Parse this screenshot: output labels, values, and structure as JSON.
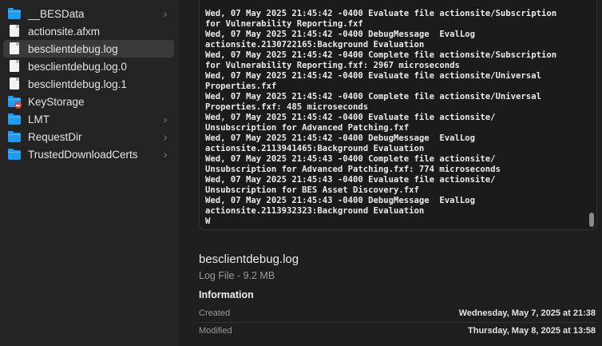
{
  "sidebar": {
    "items": [
      {
        "label": "__BESData",
        "icon": "folder-icon",
        "chevron": "›"
      },
      {
        "label": "actionsite.afxm",
        "icon": "document-icon",
        "chevron": ""
      },
      {
        "label": "besclientdebug.log",
        "icon": "document-icon",
        "chevron": ""
      },
      {
        "label": "besclientdebug.log.0",
        "icon": "document-icon",
        "chevron": ""
      },
      {
        "label": "besclientdebug.log.1",
        "icon": "document-icon",
        "chevron": ""
      },
      {
        "label": "KeyStorage",
        "icon": "folder-restricted-icon",
        "chevron": ""
      },
      {
        "label": "LMT",
        "icon": "folder-icon",
        "chevron": "›"
      },
      {
        "label": "RequestDir",
        "icon": "folder-icon",
        "chevron": "›"
      },
      {
        "label": "TrustedDownloadCerts",
        "icon": "folder-icon",
        "chevron": "›"
      }
    ],
    "selected_index": 2
  },
  "preview": {
    "log_lines": [
      "Wed, 07 May 2025 21:45:42 -0400 Evaluate file actionsite/Subscription",
      "for Vulnerability Reporting.fxf",
      "Wed, 07 May 2025 21:45:42 -0400 DebugMessage  EvalLog",
      "actionsite.2130722165:Background Evaluation",
      "Wed, 07 May 2025 21:45:42 -0400 Complete file actionsite/Subscription",
      "for Vulnerability Reporting.fxf: 2967 microseconds",
      "Wed, 07 May 2025 21:45:42 -0400 Evaluate file actionsite/Universal",
      "Properties.fxf",
      "Wed, 07 May 2025 21:45:42 -0400 Complete file actionsite/Universal",
      "Properties.fxf: 485 microseconds",
      "Wed, 07 May 2025 21:45:42 -0400 Evaluate file actionsite/",
      "Unsubscription for Advanced Patching.fxf",
      "Wed, 07 May 2025 21:45:42 -0400 DebugMessage  EvalLog",
      "actionsite.2113941465:Background Evaluation",
      "Wed, 07 May 2025 21:45:43 -0400 Complete file actionsite/",
      "Unsubscription for Advanced Patching.fxf: 774 microseconds",
      "Wed, 07 May 2025 21:45:43 -0400 Evaluate file actionsite/",
      "Unsubscription for BES Asset Discovery.fxf",
      "Wed, 07 May 2025 21:45:43 -0400 DebugMessage  EvalLog",
      "actionsite.2113932323:Background Evaluation",
      "W"
    ]
  },
  "details": {
    "file_name": "besclientdebug.log",
    "file_kind_size": "Log File - 9.2 MB",
    "section_title": "Information",
    "created_label": "Created",
    "created_value": "Wednesday, May 7, 2025 at 21:38",
    "modified_label": "Modified",
    "modified_value": "Thursday, May 8, 2025 at 13:58"
  }
}
